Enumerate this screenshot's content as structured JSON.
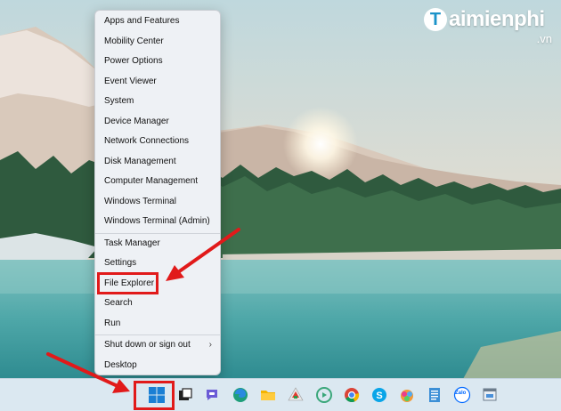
{
  "watermark": {
    "logo_letter": "T",
    "brand": "aimienphi",
    "suffix": ".vn"
  },
  "context_menu": {
    "items": [
      {
        "label": "Apps and Features"
      },
      {
        "label": "Mobility Center"
      },
      {
        "label": "Power Options"
      },
      {
        "label": "Event Viewer"
      },
      {
        "label": "System"
      },
      {
        "label": "Device Manager"
      },
      {
        "label": "Network Connections"
      },
      {
        "label": "Disk Management"
      },
      {
        "label": "Computer Management"
      },
      {
        "label": "Windows Terminal"
      },
      {
        "label": "Windows Terminal (Admin)"
      },
      {
        "label": "Task Manager"
      },
      {
        "label": "Settings"
      },
      {
        "label": "File Explorer",
        "highlighted": true
      },
      {
        "label": "Search"
      },
      {
        "label": "Run"
      },
      {
        "label": "Shut down or sign out",
        "submenu": true
      },
      {
        "label": "Desktop"
      }
    ],
    "submenu_glyph": "›"
  },
  "taskbar": {
    "icons": [
      "windows-start-icon",
      "task-view-icon",
      "chat-icon",
      "edge-icon",
      "file-explorer-icon",
      "microsoft-store-icon",
      "android-app-icon",
      "chrome-icon",
      "skype-icon",
      "colorful-app-icon",
      "notepad-icon",
      "zalo-icon",
      "app-window-icon"
    ],
    "zalo_label": "Zalo"
  },
  "annotation_color": "#e11a1a"
}
